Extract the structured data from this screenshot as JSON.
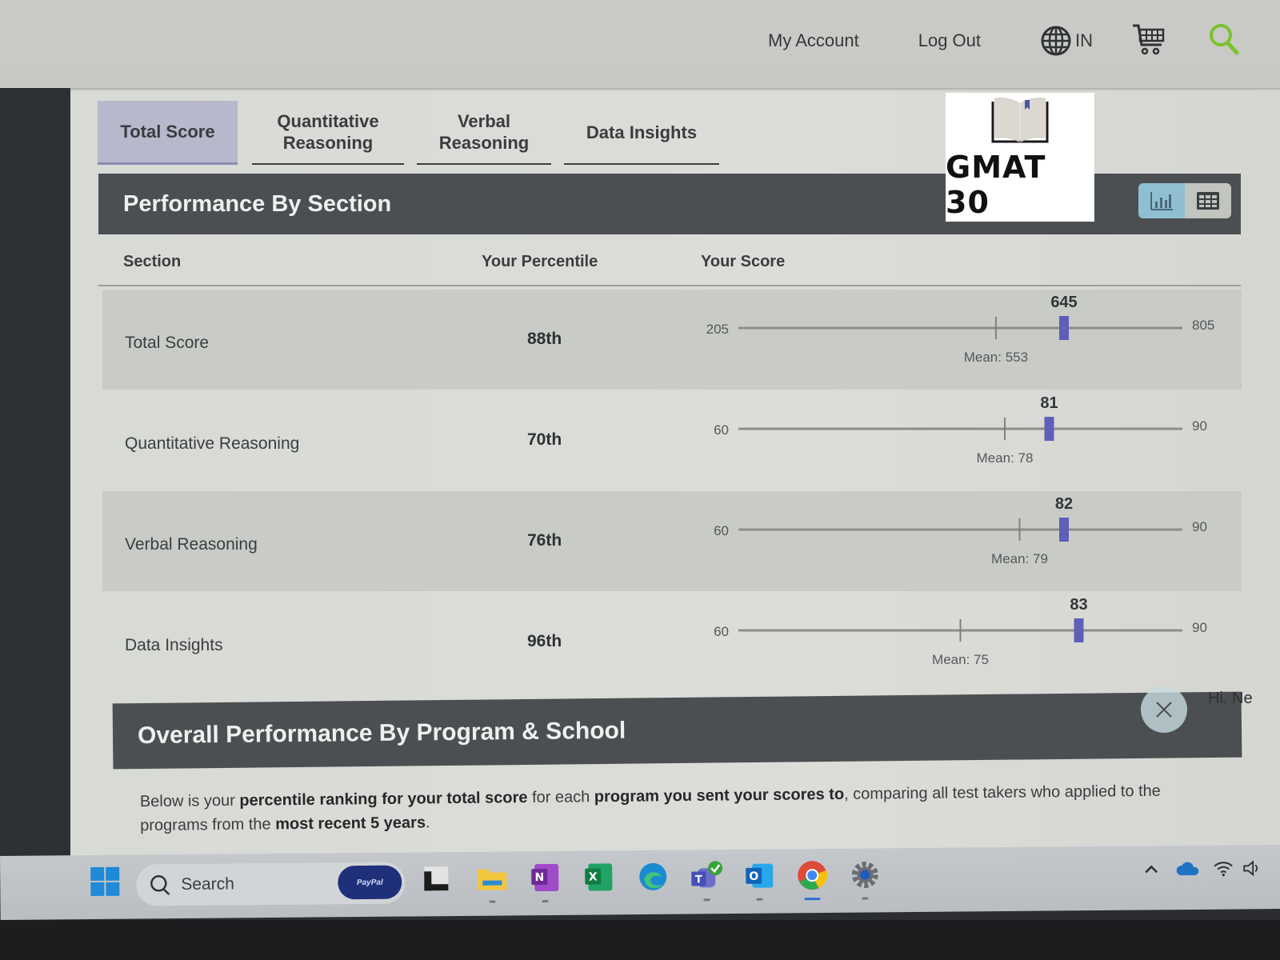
{
  "header": {
    "nav": {
      "my_account": "My Account",
      "log_out": "Log Out",
      "language": "IN"
    },
    "icons": [
      "globe-icon",
      "cart-icon",
      "search-icon"
    ],
    "search_icon_color": "#7cc22e"
  },
  "tabs": [
    {
      "label": "Total Score",
      "active": true
    },
    {
      "label": "Quantitative Reasoning",
      "active": false
    },
    {
      "label": "Verbal Reasoning",
      "active": false
    },
    {
      "label": "Data Insights",
      "active": false
    }
  ],
  "logo": {
    "text": "GMAT 30"
  },
  "performance": {
    "title": "Performance By Section",
    "view_toggle": {
      "chart_label": "chart-view",
      "table_label": "table-view",
      "selected": "chart"
    },
    "columns": {
      "section": "Section",
      "percentile": "Your Percentile",
      "score": "Your Score"
    },
    "rows": [
      {
        "section": "Total Score",
        "percentile": "88th",
        "score": 645,
        "min": 205,
        "max": 805,
        "mean": 553,
        "score_label": "645",
        "min_label": "205",
        "max_label": "805",
        "mean_label": "Mean: 553"
      },
      {
        "section": "Quantitative Reasoning",
        "percentile": "70th",
        "score": 81,
        "min": 60,
        "max": 90,
        "mean": 78,
        "score_label": "81",
        "min_label": "60",
        "max_label": "90",
        "mean_label": "Mean: 78"
      },
      {
        "section": "Verbal Reasoning",
        "percentile": "76th",
        "score": 82,
        "min": 60,
        "max": 90,
        "mean": 79,
        "score_label": "82",
        "min_label": "60",
        "max_label": "90",
        "mean_label": "Mean: 79"
      },
      {
        "section": "Data Insights",
        "percentile": "96th",
        "score": 83,
        "min": 60,
        "max": 90,
        "mean": 75,
        "score_label": "83",
        "min_label": "60",
        "max_label": "90",
        "mean_label": "Mean: 75"
      }
    ],
    "marker_color": "#5d5fb8"
  },
  "program": {
    "title": "Overall Performance By Program & School",
    "desc_parts": [
      {
        "t": "Below is your ",
        "b": false
      },
      {
        "t": "percentile ranking for your total score",
        "b": true
      },
      {
        "t": " for each ",
        "b": false
      },
      {
        "t": "program you sent your scores to",
        "b": true
      },
      {
        "t": ", comparing all test takers who applied to the programs from the ",
        "b": false
      },
      {
        "t": "most recent 5 years",
        "b": true
      },
      {
        "t": ".",
        "b": false
      }
    ]
  },
  "chat": {
    "greeting": "Hi. Ne"
  },
  "taskbar": {
    "search_placeholder": "Search",
    "paypal_label": "PayPal",
    "apps": [
      "start-icon",
      "paypal",
      "terminal",
      "file-explorer",
      "onenote",
      "excel",
      "edge",
      "teams",
      "outlook",
      "chrome",
      "settings"
    ],
    "tray": [
      "chevron-up-icon",
      "onedrive-icon",
      "wifi-icon",
      "volume-icon"
    ]
  }
}
